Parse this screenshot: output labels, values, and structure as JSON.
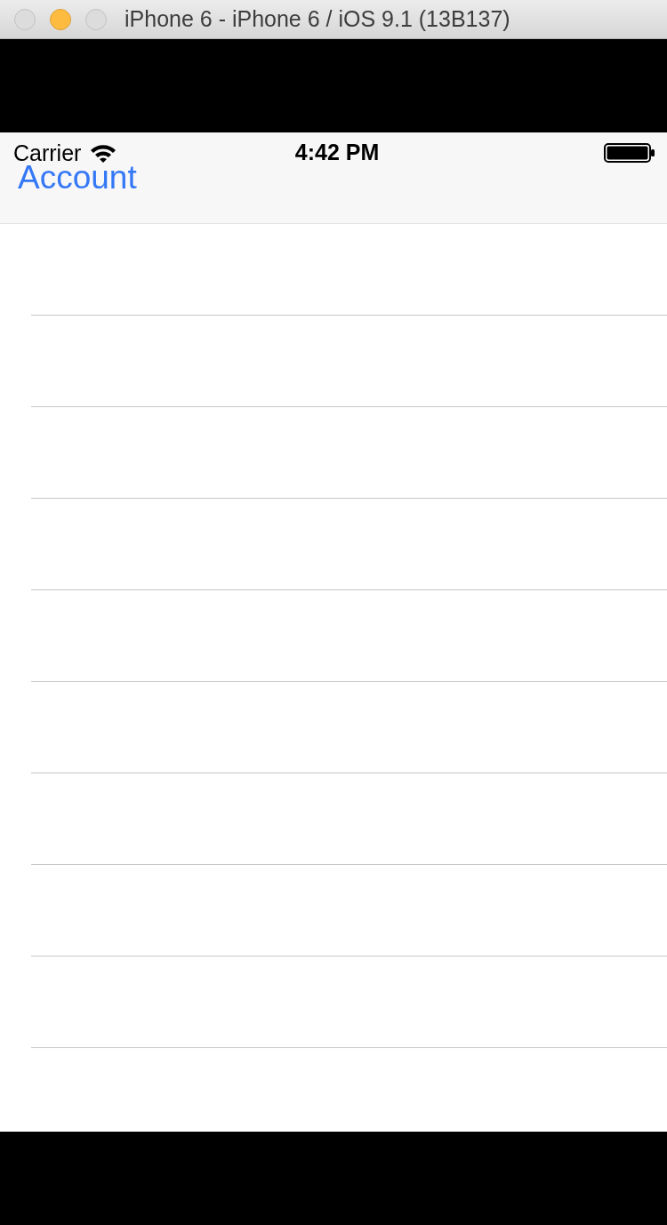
{
  "window": {
    "title": "iPhone 6 - iPhone 6 / iOS 9.1 (13B137)"
  },
  "status_bar": {
    "carrier": "Carrier",
    "time": "4:42 PM"
  },
  "navigation_bar": {
    "back_button": "Account"
  }
}
